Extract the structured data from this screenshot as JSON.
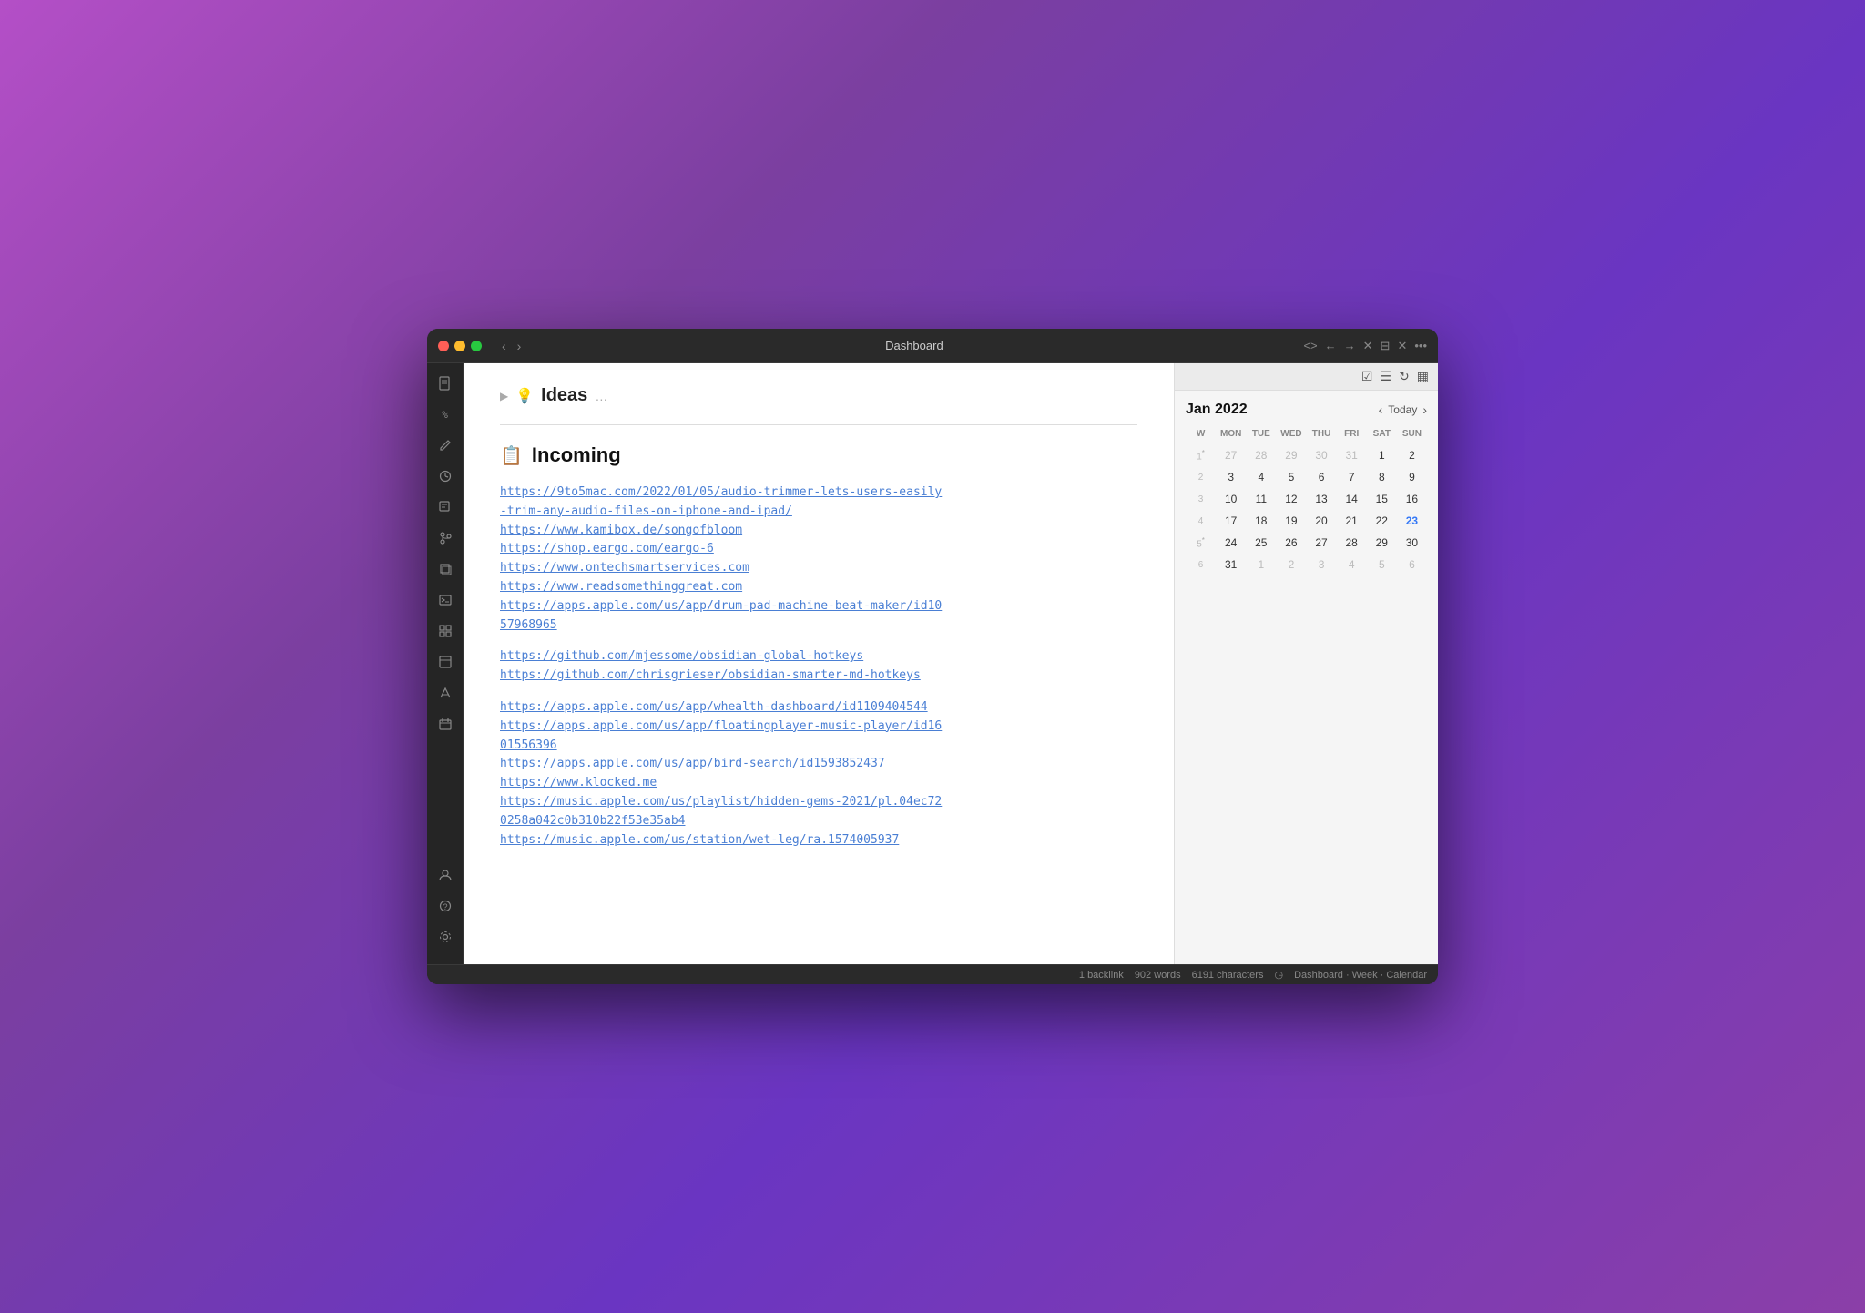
{
  "window": {
    "title": "Dashboard"
  },
  "titlebar": {
    "back_label": "‹",
    "forward_label": "›",
    "title": "Dashboard",
    "controls": [
      "<>",
      "←",
      "→",
      "✕",
      "⊟",
      "✕",
      "•••"
    ]
  },
  "sidebar": {
    "icons": [
      {
        "name": "pdf-icon",
        "symbol": "⌥"
      },
      {
        "name": "percent-icon",
        "symbol": "<%"
      },
      {
        "name": "pencil-icon",
        "symbol": "✏"
      },
      {
        "name": "clock-icon",
        "symbol": "◷"
      },
      {
        "name": "search-icon",
        "symbol": "⊡"
      },
      {
        "name": "git-icon",
        "symbol": "⌥"
      },
      {
        "name": "layers-icon",
        "symbol": "❐"
      },
      {
        "name": "terminal-icon",
        "symbol": ">_"
      },
      {
        "name": "grid-icon",
        "symbol": "⊞"
      },
      {
        "name": "panel-icon",
        "symbol": "▤"
      },
      {
        "name": "send-icon",
        "symbol": "➤"
      },
      {
        "name": "calendar-icon",
        "symbol": "▦"
      },
      {
        "name": "person-icon",
        "symbol": "⊡"
      },
      {
        "name": "help-icon",
        "symbol": "?"
      },
      {
        "name": "settings-icon",
        "symbol": "⚙"
      }
    ]
  },
  "editor": {
    "ideas_section": {
      "arrow": "▶",
      "icon": "💡",
      "title": "Ideas",
      "dots": "…"
    },
    "incoming_section": {
      "icon": "📋",
      "title": "Incoming",
      "links": [
        {
          "group": 1,
          "urls": [
            "https://9to5mac.com/2022/01/05/audio-trimmer-lets-users-easily-trim-any-audio-files-on-iphone-and-ipad/",
            "https://www.kamibox.de/songofbloom",
            "https://shop.eargo.com/eargo-6",
            "https://www.ontechsmartservices.com",
            "https://www.readsomethinggreat.com",
            "https://apps.apple.com/us/app/drum-pad-machine-beat-maker/id1057968965"
          ]
        },
        {
          "group": 2,
          "urls": [
            "https://github.com/mjessome/obsidian-global-hotkeys",
            "https://github.com/chrisgrieser/obsidian-smarter-md-hotkeys"
          ]
        },
        {
          "group": 3,
          "urls": [
            "https://apps.apple.com/us/app/whealth-dashboard/id1109404544",
            "https://apps.apple.com/us/app/floatingplayer-music-player/id1601556396",
            "https://apps.apple.com/us/app/bird-search/id1593852437",
            "https://www.klocked.me",
            "https://music.apple.com/us/playlist/hidden-gems-2021/pl.04ec720258a042c0b310b22f53e35ab4",
            "https://music.apple.com/us/station/wet-leg/ra.1574005937"
          ]
        }
      ]
    }
  },
  "calendar": {
    "month_year": "Jan 2022",
    "today_label": "Today",
    "day_headers": [
      "W",
      "MON",
      "TUE",
      "WED",
      "THU",
      "FRI",
      "SAT",
      "SUN"
    ],
    "today_date": 23,
    "weeks": [
      {
        "week_num": "1",
        "dot": "*",
        "days": [
          "27",
          "28",
          "29",
          "30",
          "31",
          "1",
          "2"
        ],
        "other": [
          true,
          true,
          true,
          true,
          true,
          false,
          false
        ]
      },
      {
        "week_num": "2",
        "dot": "",
        "days": [
          "3",
          "4",
          "5",
          "6",
          "7",
          "8",
          "9"
        ],
        "other": [
          false,
          false,
          false,
          false,
          false,
          false,
          false
        ]
      },
      {
        "week_num": "3",
        "dot": "",
        "days": [
          "10",
          "11",
          "12",
          "13",
          "14",
          "15",
          "16"
        ],
        "other": [
          false,
          false,
          false,
          false,
          false,
          false,
          false
        ]
      },
      {
        "week_num": "4",
        "dot": "",
        "days": [
          "17",
          "18",
          "19",
          "20",
          "21",
          "22",
          "23"
        ],
        "other": [
          false,
          false,
          false,
          false,
          false,
          false,
          false
        ]
      },
      {
        "week_num": "5",
        "dot": "*",
        "days": [
          "24",
          "25",
          "26",
          "27",
          "28",
          "29",
          "30"
        ],
        "other": [
          false,
          false,
          false,
          false,
          false,
          false,
          false
        ]
      },
      {
        "week_num": "6",
        "dot": "",
        "days": [
          "31",
          "1",
          "2",
          "3",
          "4",
          "5",
          "6"
        ],
        "other": [
          false,
          true,
          true,
          true,
          true,
          true,
          true
        ]
      }
    ]
  },
  "statusbar": {
    "backlink": "1 backlink",
    "words": "902 words",
    "characters": "6191 characters",
    "clock_icon": "◷",
    "location": "Dashboard · Week · Calendar"
  }
}
